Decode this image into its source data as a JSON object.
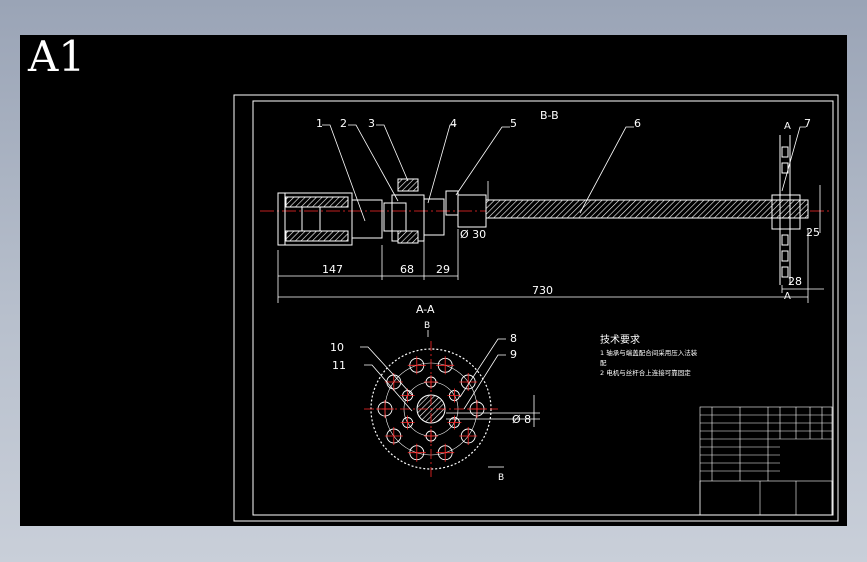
{
  "sheet": {
    "size_label": "A1"
  },
  "section_labels": {
    "bb": "B-B",
    "aa": "A-A",
    "a_mark_top": "A",
    "a_mark_bottom": "A",
    "b_mark_top": "B",
    "b_mark_bottom": "B"
  },
  "part_numbers": {
    "p1": "1",
    "p2": "2",
    "p3": "3",
    "p4": "4",
    "p5": "5",
    "p6": "6",
    "p7": "7",
    "p8": "8",
    "p9": "9",
    "p10": "10",
    "p11": "11"
  },
  "dimensions": {
    "d147": "147",
    "d68": "68",
    "d29": "29",
    "d730": "730",
    "dia30": "Ø 30",
    "d25": "25",
    "d28": "28",
    "dia8": "Ø 8"
  },
  "notes": {
    "title": "技术要求",
    "line1": "1 轴承与端盖配合间采用压入法装",
    "line2": "配",
    "line3": "2 电机与丝杆合上连接可靠固定"
  },
  "colors": {
    "background": "#000000",
    "line": "#ffffff",
    "accent": "#ff2a2a",
    "window_bg": "#a4adbf"
  }
}
